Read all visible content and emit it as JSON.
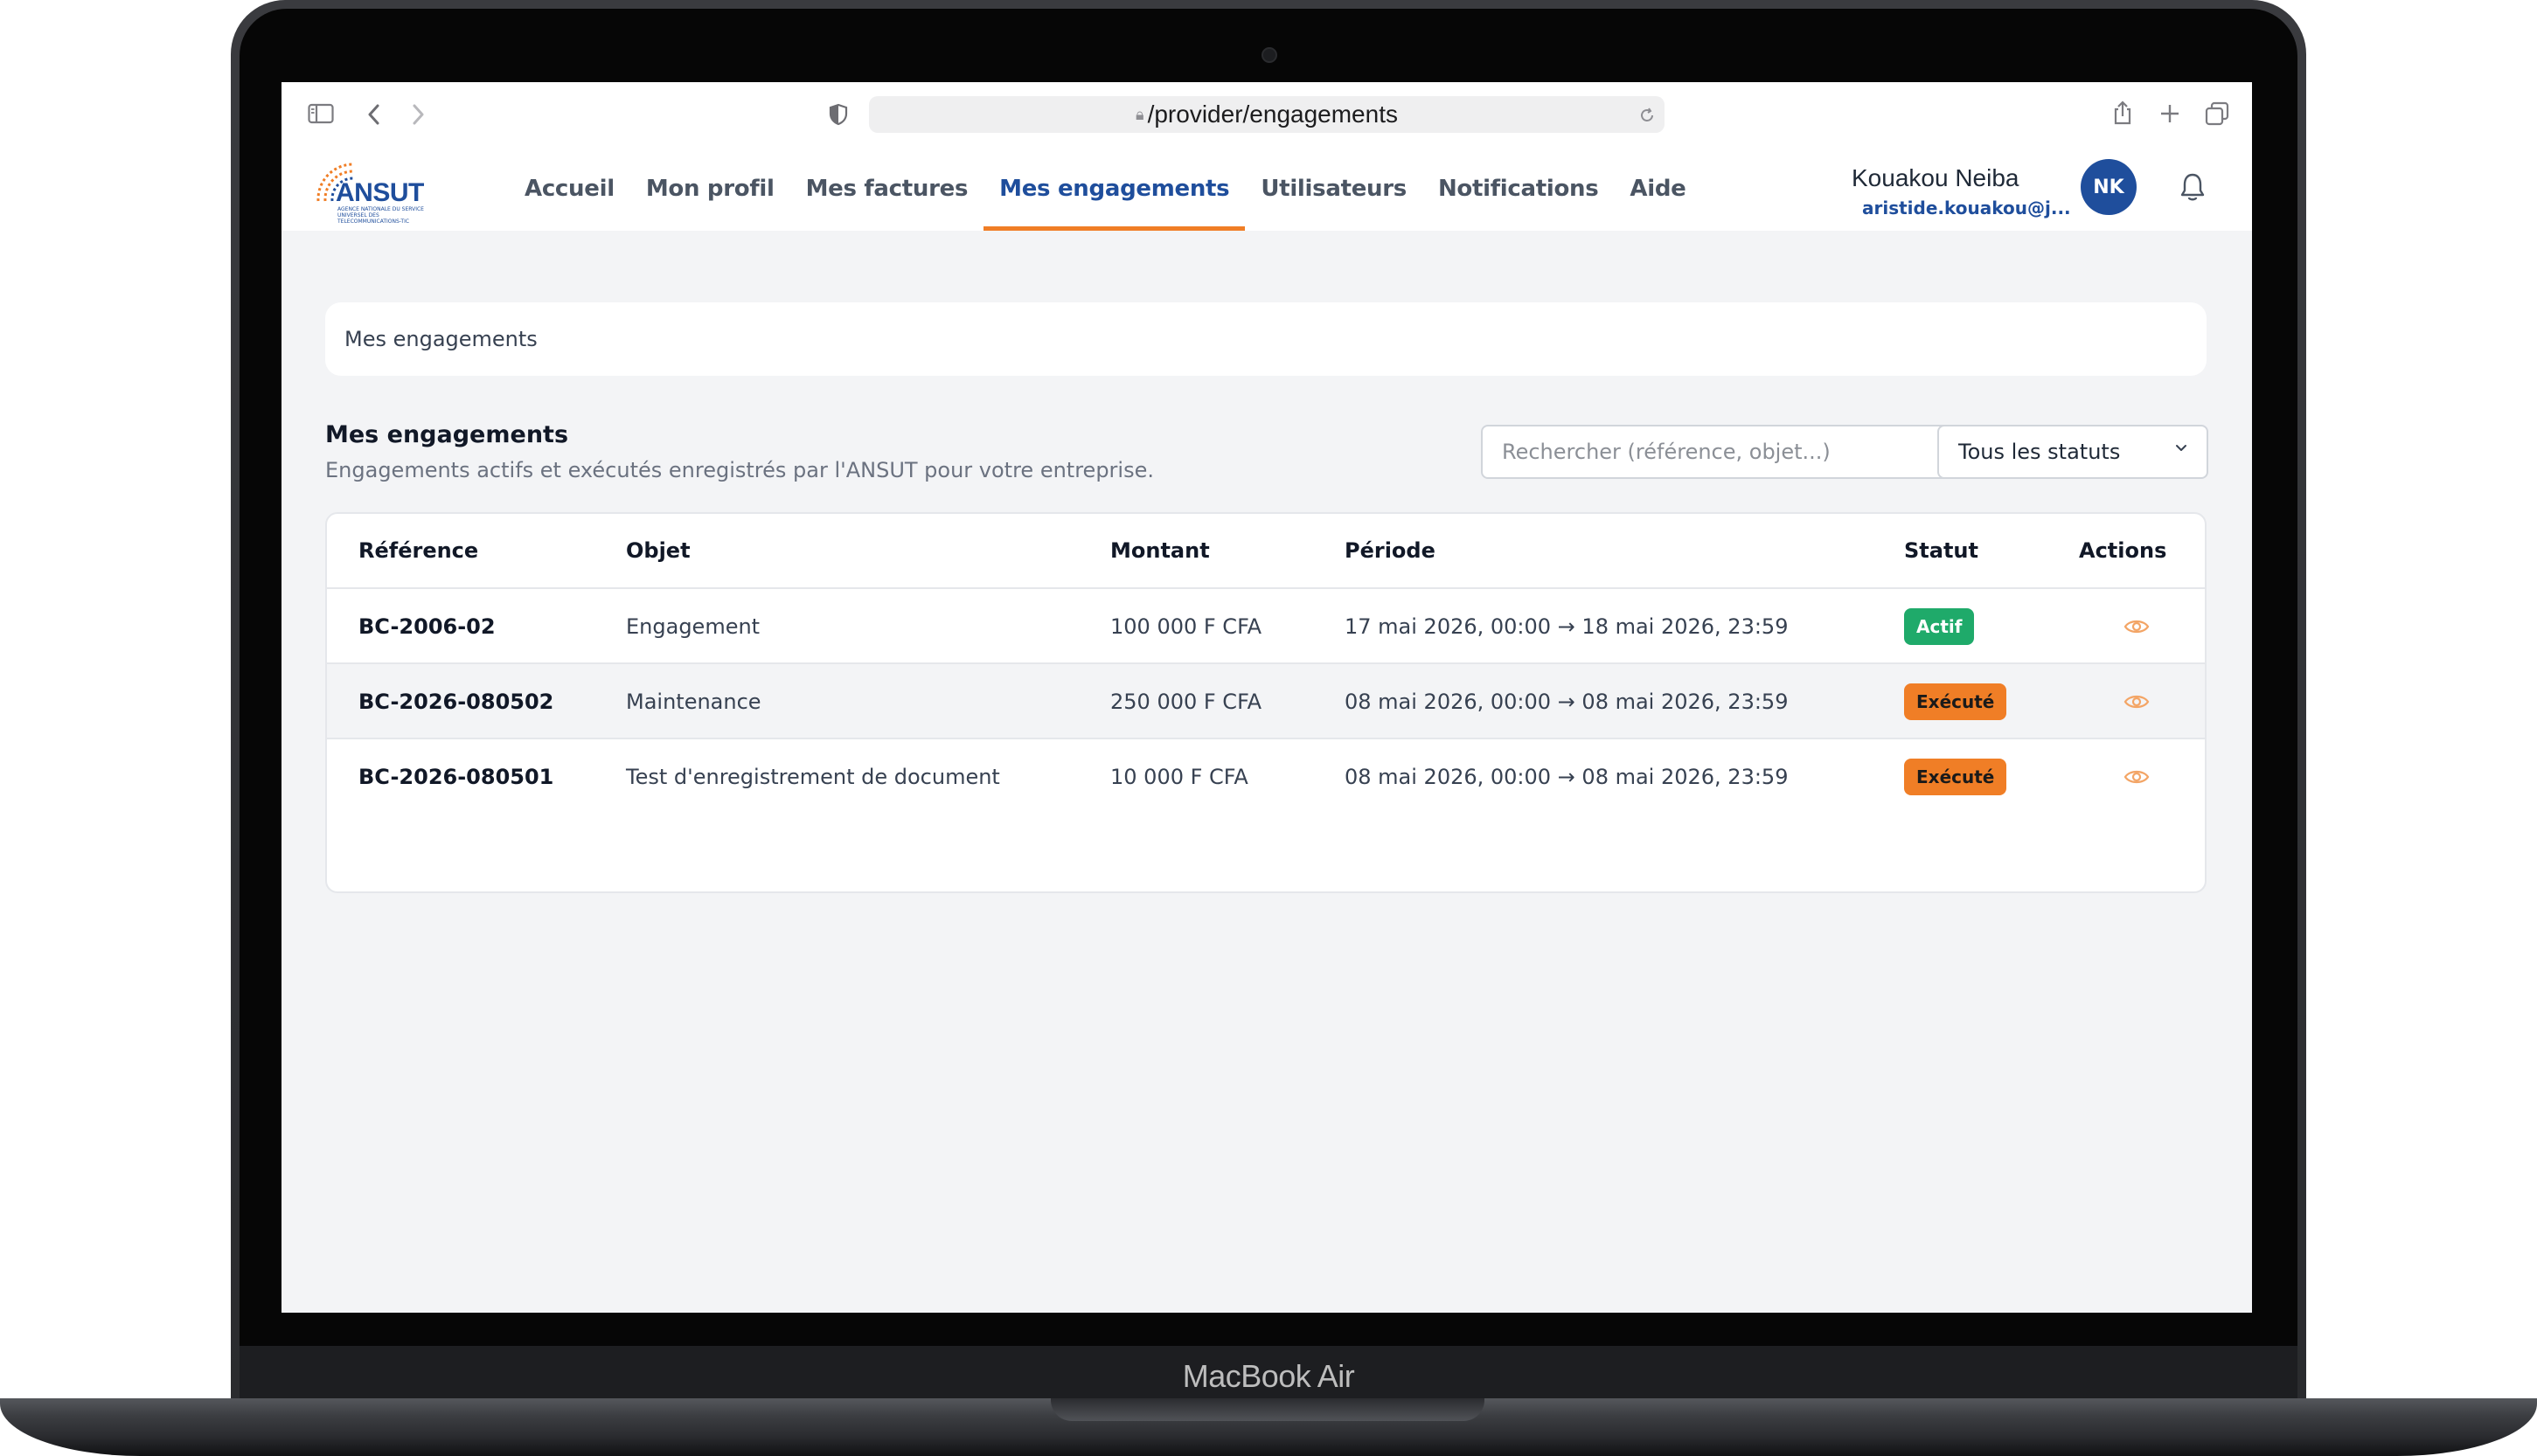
{
  "device": {
    "label": "MacBook Air"
  },
  "browser": {
    "url": "/provider/engagements",
    "icons": [
      "sidebar-icon",
      "back-icon",
      "forward-icon",
      "shield-icon",
      "lock-icon",
      "reload-icon",
      "share-icon",
      "new-tab-icon",
      "tabs-overview-icon"
    ]
  },
  "app": {
    "logo_text": "ANSUT",
    "logo_tagline": "AGENCE NATIONALE DU SERVICE UNIVERSEL DES TELECOMMUNICATIONS-TIC",
    "nav": [
      {
        "label": "Accueil",
        "active": false
      },
      {
        "label": "Mon profil",
        "active": false
      },
      {
        "label": "Mes factures",
        "active": false
      },
      {
        "label": "Mes engagements",
        "active": true
      },
      {
        "label": "Utilisateurs",
        "active": false
      },
      {
        "label": "Notifications",
        "active": false
      },
      {
        "label": "Aide",
        "active": false
      }
    ],
    "user": {
      "name": "Kouakou Neiba",
      "email": "aristide.kouakou@j...",
      "initials": "NK"
    }
  },
  "breadcrumb": {
    "label": "Mes engagements"
  },
  "section": {
    "title": "Mes engagements",
    "subtitle": "Engagements actifs et exécutés enregistrés par l'ANSUT pour votre entreprise.",
    "search_placeholder": "Rechercher (référence, objet...)",
    "status_filter": "Tous les statuts"
  },
  "table": {
    "columns": [
      "Référence",
      "Objet",
      "Montant",
      "Période",
      "Statut",
      "Actions"
    ],
    "rows": [
      {
        "reference": "BC-2006-02",
        "objet": "Engagement",
        "montant": "100 000 F CFA",
        "periode": "17 mai 2026, 00:00 → 18 mai 2026, 23:59",
        "statut": "Actif"
      },
      {
        "reference": "BC-2026-080502",
        "objet": "Maintenance",
        "montant": "250 000 F CFA",
        "periode": "08 mai 2026, 00:00 → 08 mai 2026, 23:59",
        "statut": "Exécuté"
      },
      {
        "reference": "BC-2026-080501",
        "objet": "Test d'enregistrement de document",
        "montant": "10 000 F CFA",
        "periode": "08 mai 2026, 00:00 → 08 mai 2026, 23:59",
        "statut": "Exécuté"
      }
    ]
  },
  "colors": {
    "brand_blue": "#1f4e9c",
    "accent_orange": "#f07e26",
    "status_actif": "#1faa6a",
    "status_execute": "#f07e26"
  }
}
